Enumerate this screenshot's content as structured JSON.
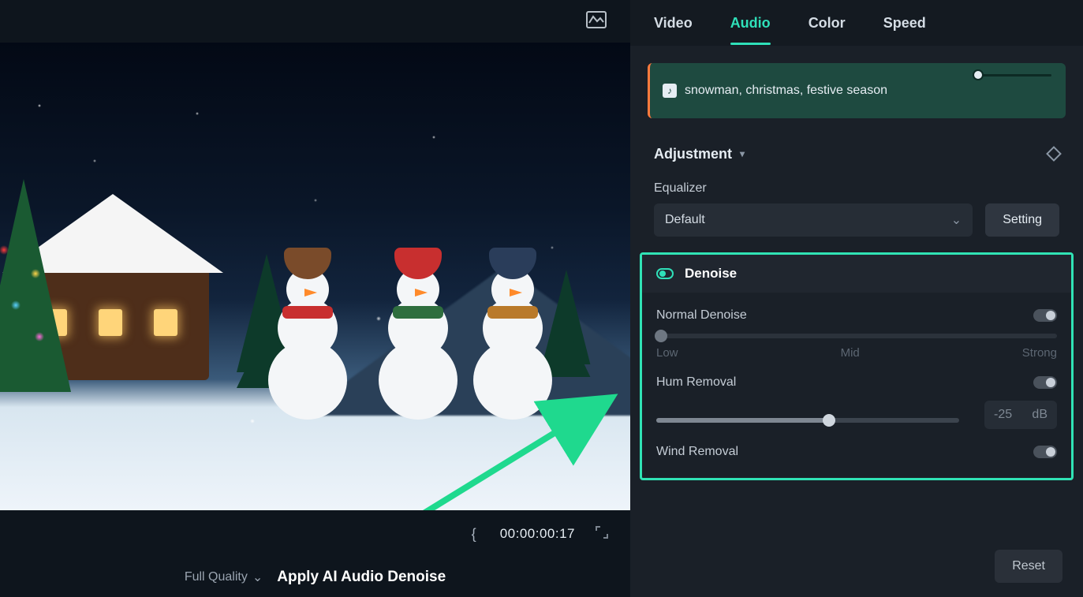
{
  "preview": {
    "timecode": "00:00:00:17",
    "brace_left": "{",
    "quality_label": "Full Quality",
    "caption": "Apply AI Audio Denoise"
  },
  "tabs": {
    "video": "Video",
    "audio": "Audio",
    "color": "Color",
    "speed": "Speed",
    "active": "audio"
  },
  "clip": {
    "title": "snowman, christmas, festive season"
  },
  "adjustment": {
    "header": "Adjustment",
    "equalizer_label": "Equalizer",
    "equalizer_value": "Default",
    "setting_button": "Setting"
  },
  "denoise": {
    "header": "Denoise",
    "normal_label": "Normal Denoise",
    "legend_low": "Low",
    "legend_mid": "Mid",
    "legend_strong": "Strong",
    "hum_label": "Hum Removal",
    "hum_value": "-25",
    "hum_unit": "dB",
    "wind_label": "Wind Removal"
  },
  "footer": {
    "reset": "Reset"
  }
}
